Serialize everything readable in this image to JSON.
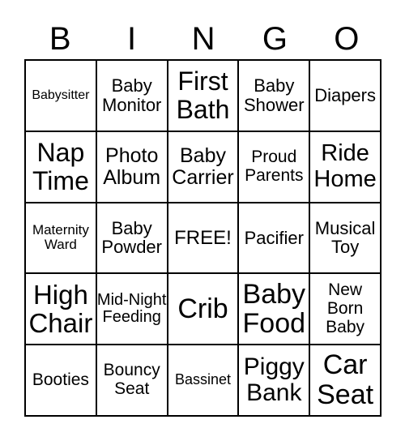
{
  "header": [
    "B",
    "I",
    "N",
    "G",
    "O"
  ],
  "cells": [
    "Babysitter",
    "Baby Monitor",
    "First Bath",
    "Baby Shower",
    "Diapers",
    "Nap Time",
    "Photo Album",
    "Baby Carrier",
    "Proud Parents",
    "Ride Home",
    "Maternity Ward",
    "Baby Powder",
    "FREE!",
    "Pacifier",
    "Musical Toy",
    "High Chair",
    "Mid-Night Feeding",
    "Crib",
    "Baby Food",
    "New Born Baby",
    "Booties",
    "Bouncy Seat",
    "Bassinet",
    "Piggy Bank",
    "Car Seat"
  ]
}
